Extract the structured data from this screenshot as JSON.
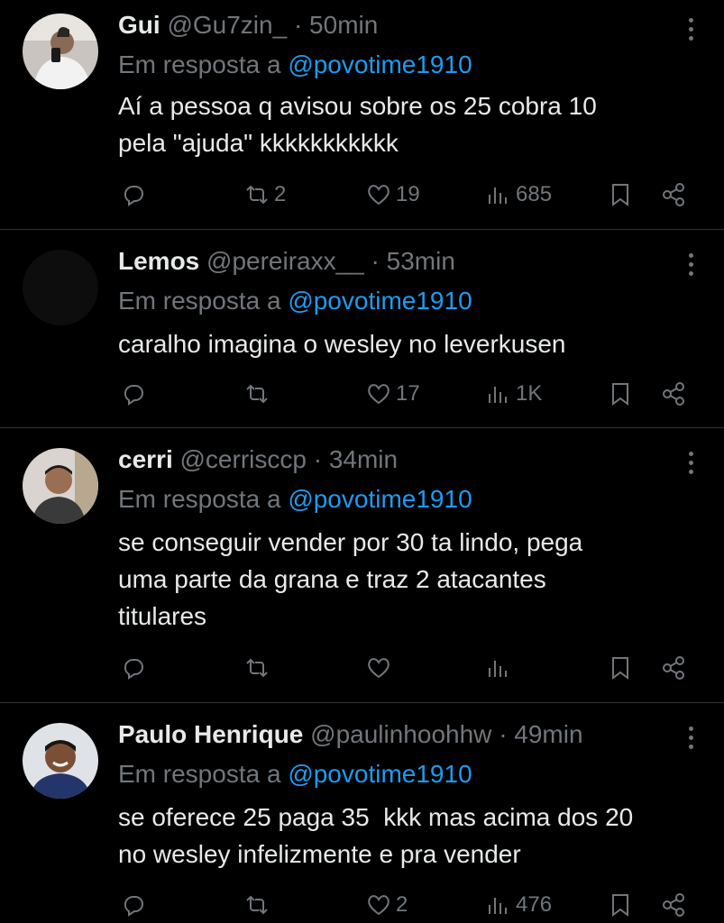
{
  "tweets": [
    {
      "name": "Gui",
      "handle": "@Gu7zin_",
      "time": "· 50min",
      "reply_prefix": "Em resposta a ",
      "reply_to": "@povotime1910",
      "text": "Aí a pessoa q avisou sobre os 25 cobra 10\npela \"ajuda\" kkkkkkkkkkk",
      "retweets": "2",
      "likes": "19",
      "views": "685"
    },
    {
      "name": "Lemos",
      "handle": "@pereiraxx__",
      "time": "· 53min",
      "reply_prefix": "Em resposta a ",
      "reply_to": "@povotime1910",
      "text": "caralho imagina o wesley no leverkusen",
      "retweets": "",
      "likes": "17",
      "views": "1K"
    },
    {
      "name": "cerri",
      "handle": "@cerrisccp",
      "time": "· 34min",
      "reply_prefix": "Em resposta a ",
      "reply_to": "@povotime1910",
      "text": "se conseguir vender por 30 ta lindo, pega\numa parte da grana e traz 2 atacantes\ntitulares",
      "retweets": "",
      "likes": "",
      "views": ""
    },
    {
      "name": "Paulo Henrique",
      "handle": "@paulinhoohhw",
      "time": "· 49min",
      "reply_prefix": "Em resposta a ",
      "reply_to": "@povotime1910",
      "text": "se oferece 25 paga 35  kkk mas acima dos 20\nno wesley infelizmente e pra vender",
      "retweets": "",
      "likes": "2",
      "views": "476"
    }
  ],
  "icons": {
    "reply": "reply-icon",
    "retweet": "retweet-icon",
    "like": "heart-icon",
    "views": "views-icon",
    "bookmark": "bookmark-icon",
    "share": "share-icon",
    "more": "more-icon"
  },
  "colors": {
    "background": "#000000",
    "text": "#e7e9ea",
    "muted": "#71767b",
    "link": "#1d9bf0",
    "divider": "#2f3336"
  }
}
